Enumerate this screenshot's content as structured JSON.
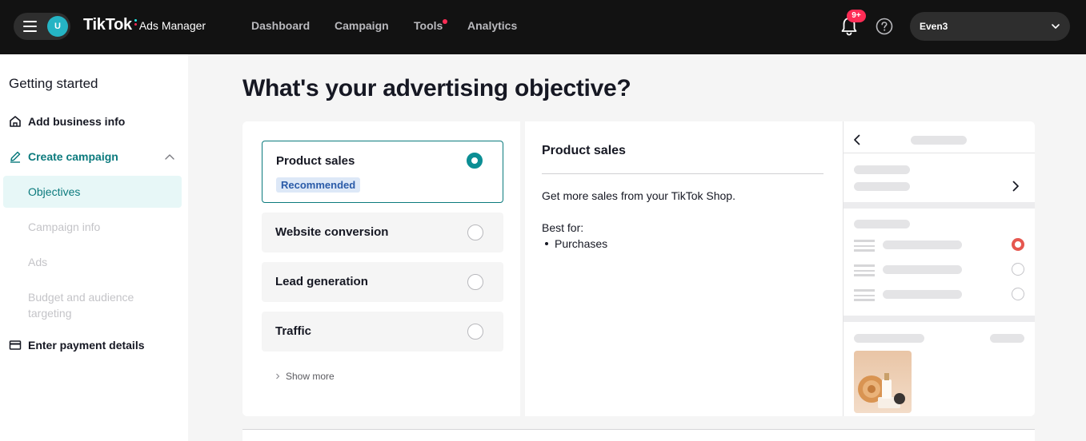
{
  "topbar": {
    "avatar_letter": "U",
    "logo_brand": "TikTok",
    "logo_product": "Ads Manager",
    "nav": [
      {
        "label": "Dashboard"
      },
      {
        "label": "Campaign"
      },
      {
        "label": "Tools"
      },
      {
        "label": "Analytics"
      }
    ],
    "notifications_badge": "9+",
    "account_name": "Even3"
  },
  "sidebar": {
    "title": "Getting started",
    "items": [
      {
        "label": "Add business info",
        "icon": "home-icon"
      },
      {
        "label": "Create campaign",
        "icon": "pencil-icon"
      },
      {
        "label": "Objectives"
      },
      {
        "label": "Campaign info"
      },
      {
        "label": "Ads"
      },
      {
        "label": "Budget and audience targeting"
      },
      {
        "label": "Enter payment details",
        "icon": "payment-card-icon"
      }
    ]
  },
  "main": {
    "title": "What's your advertising objective?",
    "objectives": [
      {
        "label": "Product sales",
        "badge": "Recommended",
        "selected": true
      },
      {
        "label": "Website conversion",
        "selected": false
      },
      {
        "label": "Lead generation",
        "selected": false
      },
      {
        "label": "Traffic",
        "selected": false
      }
    ],
    "show_more": "Show more",
    "detail": {
      "title": "Product sales",
      "description": "Get more sales from your TikTok Shop.",
      "best_for_label": "Best for:",
      "best_for_items": [
        "Purchases"
      ]
    }
  },
  "colors": {
    "topbar_bg": "#121212",
    "accent_teal": "#0b7a7d",
    "badge_red": "#fe2c55",
    "preview_radio_red": "#e6574f"
  }
}
